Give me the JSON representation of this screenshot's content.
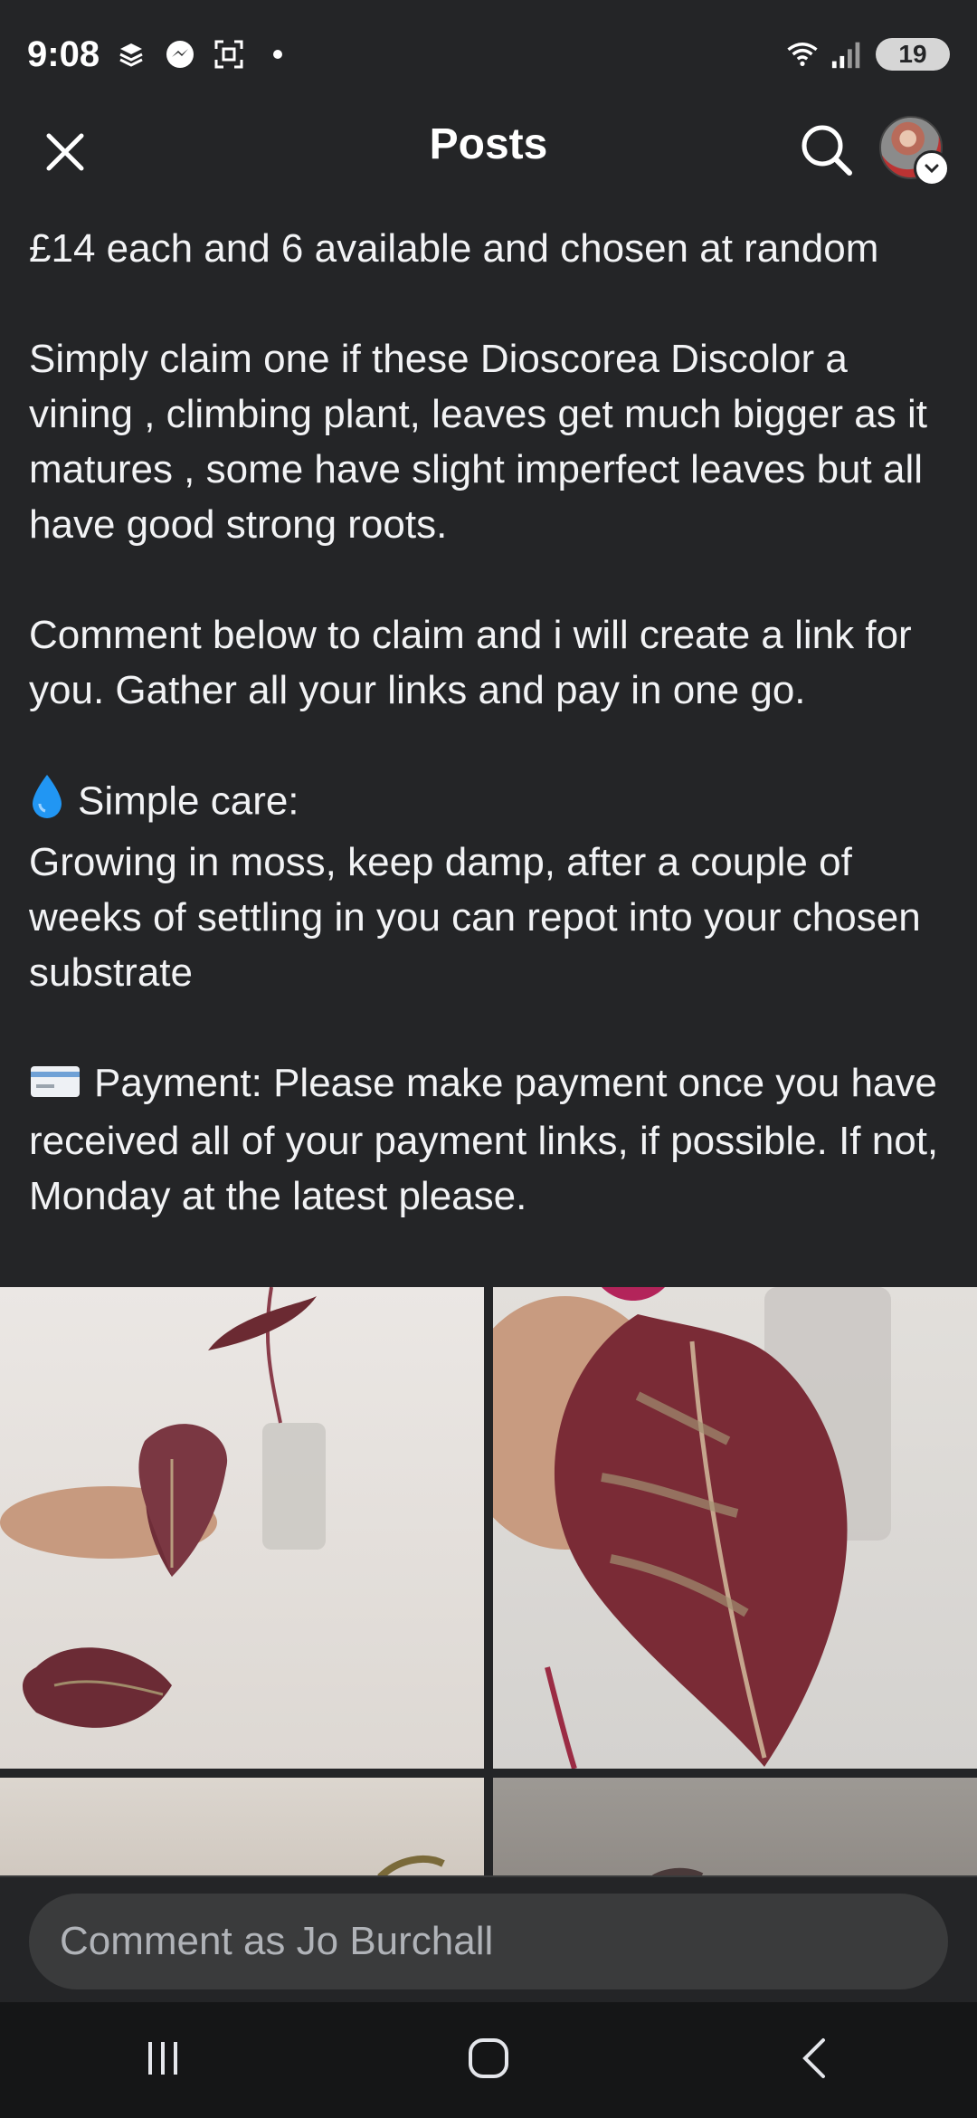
{
  "status_bar": {
    "time": "9:08",
    "battery": "19",
    "icons": [
      "layers-icon",
      "messenger-icon",
      "screenshot-icon",
      "dot-icon",
      "wifi-icon",
      "signal-icon"
    ]
  },
  "header": {
    "title": "Posts",
    "close_icon": "close-icon",
    "search_icon": "search-icon",
    "avatar_badge_icon": "chevron-down-icon"
  },
  "post": {
    "line1": "£14 each and 6 available and chosen at random",
    "para2": "Simply claim one if these Dioscorea Discolor a vining , climbing plant, leaves get much bigger as it matures , some have slight imperfect leaves but all have good strong roots.",
    "para3": "Comment below to claim and i will create a link for you. Gather all your links and pay in one go.",
    "care_heading": "Simple care:",
    "care_text": "Growing in moss, keep damp, after a couple of weeks of settling in you can repot into your chosen substrate",
    "payment_text": "Payment: Please make payment once you have received all of your payment links, if possible. If not, Monday at the latest please.",
    "care_icon": "droplet-icon",
    "payment_icon": "credit-card-icon"
  },
  "comment": {
    "placeholder": "Comment as Jo Burchall"
  },
  "nav": {
    "icons": [
      "recent-apps-icon",
      "home-icon",
      "back-icon"
    ]
  },
  "colors": {
    "background": "#242527",
    "text": "#f2f3f5",
    "input_bg": "#3a3b3c",
    "nav_bg": "#151617"
  }
}
